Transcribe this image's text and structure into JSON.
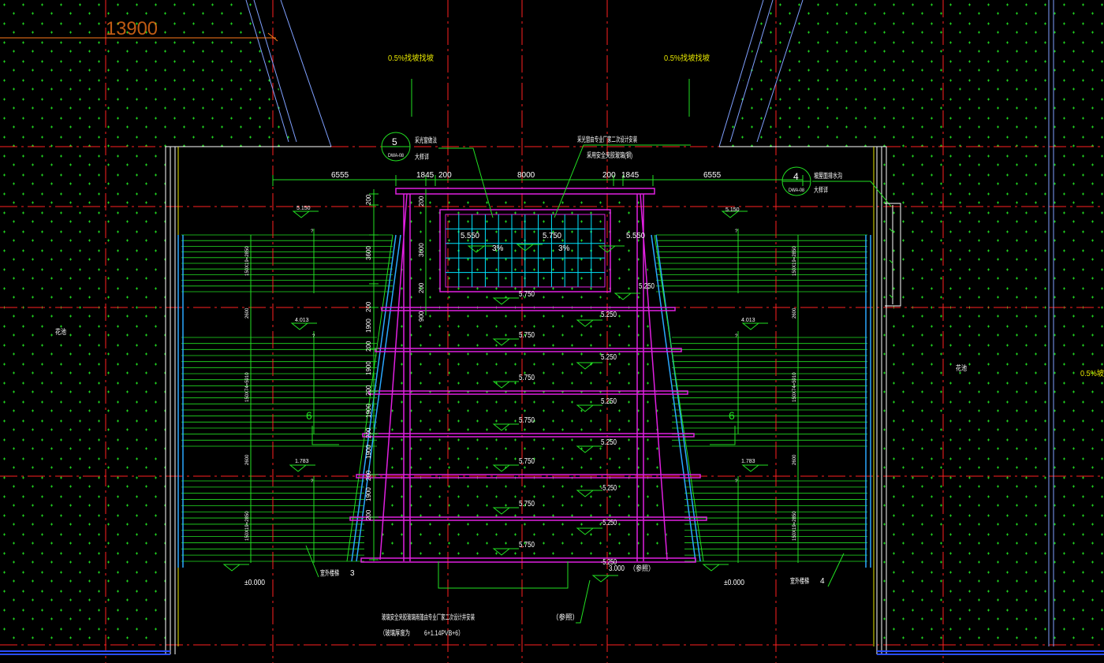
{
  "drawing": {
    "top_dimension": "13900",
    "slope_left": "0.5%找坡找坡",
    "slope_right": "0.5%找坡找坡",
    "slope_far_right": "0.5%坡",
    "callout_left": {
      "num": "5",
      "sub": "DWA-08",
      "line1": "采光窗做法",
      "line2": "大样详"
    },
    "callout_right": {
      "num": "4",
      "sub": "DWA-08",
      "line1": "坡屋面排水沟",
      "line2": "大样详"
    },
    "note_top_1": "采光窗由专业厂家二次设计安装",
    "note_top_2": "采用安全夹胶玻璃(钢)",
    "dims_top": [
      "6555",
      "1845",
      "200",
      "8000",
      "200",
      "1845",
      "6555"
    ],
    "dims_left_vertical": [
      "200",
      "3600",
      "200",
      "1900",
      "200",
      "1900",
      "200",
      "1900",
      "200",
      "1900",
      "200",
      "1900",
      "200"
    ],
    "dims_inner_vertical": [
      "200",
      "3600",
      "200",
      "900"
    ],
    "skylight_levels": [
      "5.550",
      "5.750",
      "5.550"
    ],
    "skylight_slopes": [
      "3%",
      "3%"
    ],
    "left_levels": [
      "5.750",
      "5.750",
      "5.750",
      "5.750",
      "5.750",
      "5.750",
      "5.750"
    ],
    "right_levels": [
      "5.250",
      "5.250",
      "5.250",
      "5.250",
      "-5.250",
      "-5.250",
      "-5.250",
      "5.250"
    ],
    "side_left": {
      "top": "5.150",
      "mid": "4.013",
      "low": "1.783",
      "zero": "±0.000",
      "stair": "室外楼梯",
      "stair_num": "3",
      "count": "6"
    },
    "side_right": {
      "top": "5.150",
      "mid": "4.013",
      "low": "1.783",
      "zero": "±0.000",
      "stair": "室外楼梯",
      "stair_num": "4",
      "count": "6"
    },
    "riser_left": [
      "150X19=2850",
      "2600",
      "150X74=5910",
      "2600",
      "150X19=2850"
    ],
    "riser_right": [
      "150X19=2850",
      "2600",
      "150X74=5910",
      "2600",
      "150X19=2850"
    ],
    "level_bottom": "3.000",
    "level_bottom_note": "（参照）",
    "area_left": "花池",
    "area_right": "花池",
    "note_bottom_1": "玻璃安全夹胶玻璃雨篷由专业厂家二次设计并安装",
    "note_bottom_ref": "（参照）",
    "note_bottom_2": "（玻璃厚度为",
    "note_bottom_3": "6+1.14PVB+6）"
  },
  "colors": {
    "bg": "#000000",
    "green": "#22e022",
    "red": "#ff2020",
    "magenta": "#e020e0",
    "cyan": "#00e5ff",
    "white": "#ffffff",
    "yellow": "#e6e600",
    "blue": "#2a4dff",
    "orange": "#ff7a1a"
  }
}
